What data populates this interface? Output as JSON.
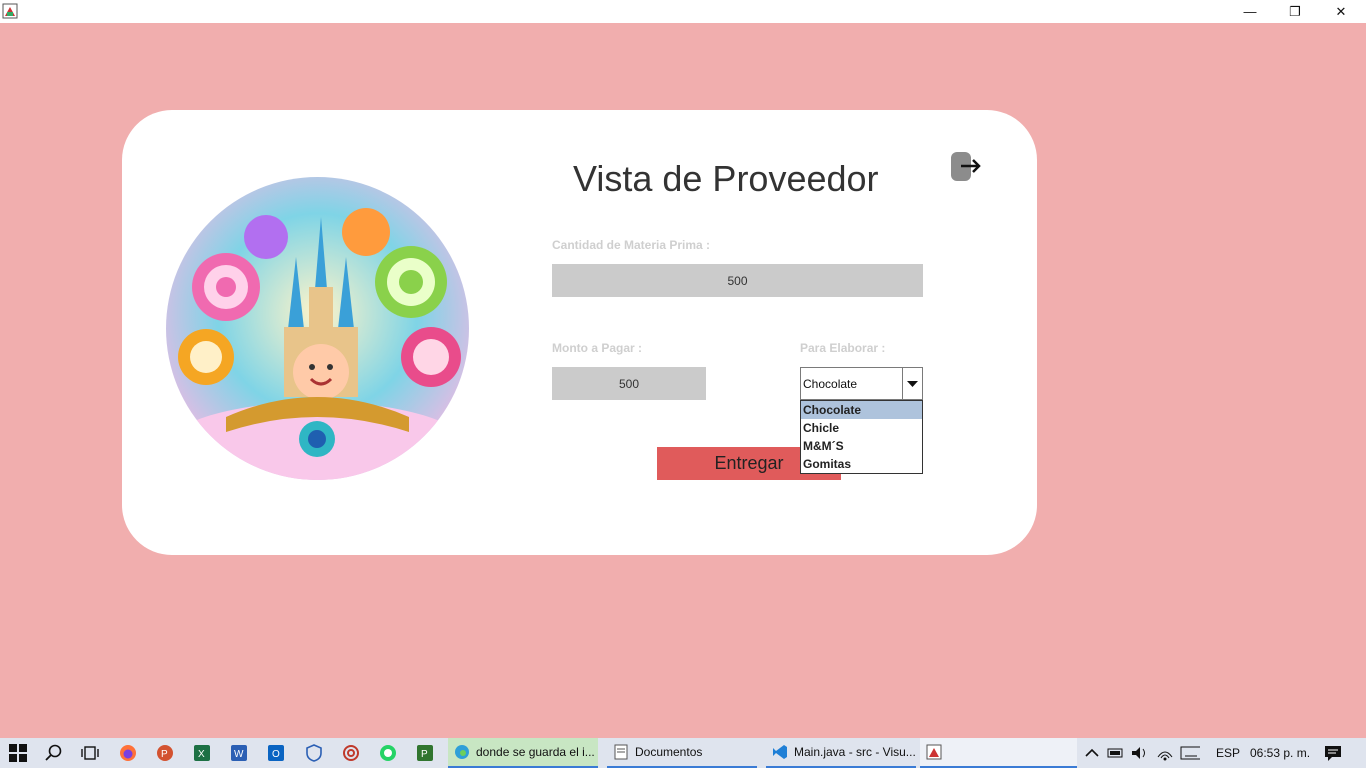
{
  "window": {
    "minimize_glyph": "—",
    "maximize_glyph": "❐",
    "close_glyph": "✕"
  },
  "form": {
    "title": "Vista de Proveedor",
    "qty_label": "Cantidad de  Materia Prima :",
    "qty_value": "500",
    "amount_label": "Monto a Pagar :",
    "amount_value": "500",
    "make_label": "Para Elaborar :",
    "make_selected": "Chocolate",
    "make_options": [
      "Chocolate",
      "Chicle",
      "M&M´S",
      "Gomitas"
    ],
    "deliver_label": "Entregar"
  },
  "taskbar": {
    "tasks": [
      {
        "label": "donde se guarda el i..."
      },
      {
        "label": "Documentos"
      },
      {
        "label": "Main.java - src - Visu..."
      }
    ],
    "language": "ESP",
    "time": "06:53 p. m."
  },
  "colors": {
    "background": "#f1aeae",
    "button": "#e05b5b",
    "field": "#cbcbcb"
  }
}
